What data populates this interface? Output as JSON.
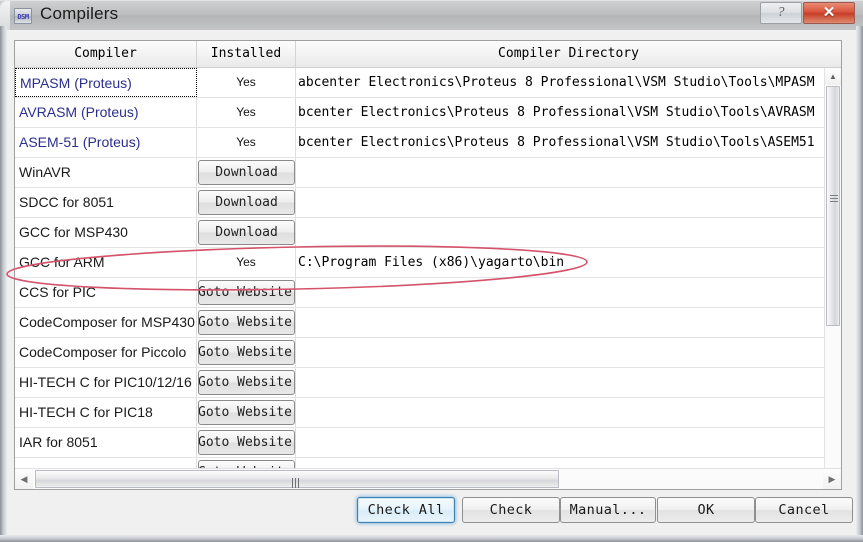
{
  "window": {
    "title": "Compilers",
    "icon": "app-icon",
    "caption_buttons": [
      {
        "name": "help-button",
        "glyph": "?"
      },
      {
        "name": "close-button",
        "glyph": "✕"
      }
    ]
  },
  "grid": {
    "columns": [
      "Compiler",
      "Installed",
      "Compiler Directory"
    ],
    "rows": [
      {
        "name": "MPASM (Proteus)",
        "style": "link",
        "installed": "Yes",
        "directory": "abcenter Electronics\\Proteus 8 Professional\\VSM Studio\\Tools\\MPASM",
        "focused": true
      },
      {
        "name": "AVRASM (Proteus)",
        "style": "link",
        "installed": "Yes",
        "directory": "bcenter Electronics\\Proteus 8 Professional\\VSM Studio\\Tools\\AVRASM",
        "focused": false
      },
      {
        "name": "ASEM-51 (Proteus)",
        "style": "link",
        "installed": "Yes",
        "directory": "bcenter Electronics\\Proteus 8 Professional\\VSM Studio\\Tools\\ASEM51",
        "focused": false
      },
      {
        "name": "WinAVR",
        "style": "normal",
        "installed": "Download",
        "directory": "",
        "focused": false
      },
      {
        "name": "SDCC for 8051",
        "style": "normal",
        "installed": "Download",
        "directory": "",
        "focused": false
      },
      {
        "name": "GCC for MSP430",
        "style": "normal",
        "installed": "Download",
        "directory": "",
        "focused": false
      },
      {
        "name": "GCC for ARM",
        "style": "normal",
        "installed": "Yes",
        "directory": "C:\\Program Files (x86)\\yagarto\\bin",
        "focused": false
      },
      {
        "name": "CCS for PIC",
        "style": "normal",
        "installed": "Goto Website",
        "directory": "",
        "focused": false
      },
      {
        "name": "CodeComposer for MSP430",
        "style": "normal",
        "installed": "Goto Website",
        "directory": "",
        "focused": false
      },
      {
        "name": "CodeComposer for Piccolo",
        "style": "normal",
        "installed": "Goto Website",
        "directory": "",
        "focused": false
      },
      {
        "name": "HI-TECH C for PIC10/12/16",
        "style": "normal",
        "installed": "Goto Website",
        "directory": "",
        "focused": false
      },
      {
        "name": "HI-TECH C for PIC18",
        "style": "normal",
        "installed": "Goto Website",
        "directory": "",
        "focused": false
      },
      {
        "name": "IAR for 8051",
        "style": "normal",
        "installed": "Goto Website",
        "directory": "",
        "focused": false
      },
      {
        "name": "",
        "style": "normal",
        "installed": "Goto Website",
        "directory": "",
        "focused": false
      }
    ]
  },
  "scrollbars": {
    "vertical": {
      "up_glyph": "▲",
      "down_glyph": "▼"
    },
    "horizontal": {
      "left_glyph": "◀",
      "right_glyph": "▶"
    }
  },
  "buttons": {
    "check_all": "Check All",
    "check": "Check",
    "manual": "Manual...",
    "ok": "OK",
    "cancel": "Cancel"
  },
  "annotation": {
    "shape": "ellipse",
    "color": "#d4536a",
    "targets_row": "GCC for ARM"
  }
}
